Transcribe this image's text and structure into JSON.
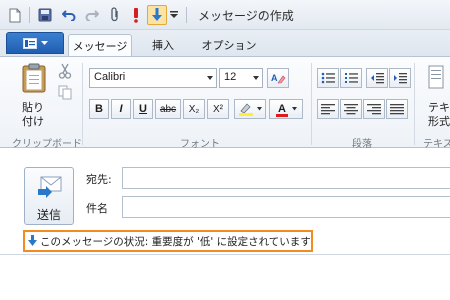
{
  "window": {
    "title": "メッセージの作成"
  },
  "ribbon": {
    "tabs": [
      {
        "label": "メッセージ",
        "active": true
      },
      {
        "label": "挿入",
        "active": false
      },
      {
        "label": "オプション",
        "active": false
      }
    ],
    "clipboard": {
      "paste_label": "貼り\n付け",
      "group_label": "クリップボード"
    },
    "font": {
      "font_name": "Calibri",
      "font_size": "12",
      "group_label": "フォント",
      "buttons": [
        "B",
        "I",
        "U",
        "abc",
        "X₂",
        "X²"
      ]
    },
    "paragraph": {
      "group_label": "段落"
    },
    "text": {
      "button_label": "テキ\n形式",
      "group_label": "テキス"
    }
  },
  "message": {
    "send_label": "送信",
    "to_label": "宛先:",
    "to_value": "",
    "subject_label": "件名",
    "subject_value": "",
    "info_text": "このメッセージの状況: 重要度が '低' に設定されています"
  },
  "colors": {
    "accent": "#1f5fb3",
    "highlight_border": "#f28c1e",
    "low_importance_arrow": "#2a78c9"
  }
}
